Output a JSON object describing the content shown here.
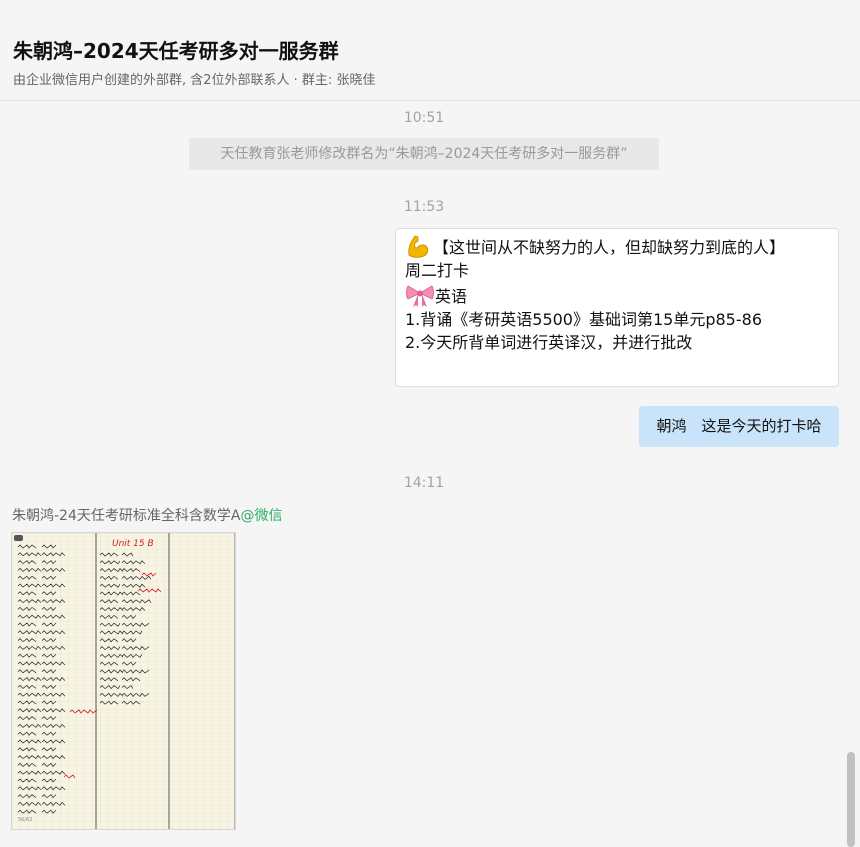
{
  "header": {
    "title": "朱朝鸿–2024天任考研多对一服务群",
    "subtitle": "由企业微信用户创建的外部群, 含2位外部联系人 · 群主: 张晓佳"
  },
  "messages": {
    "ts1": "10:51",
    "system_notice": "天任教育张老师修改群名为“朱朝鸿–2024天任考研多对一服务群”",
    "ts2": "11:53",
    "task": {
      "emoji1": "flexed-biceps-icon",
      "line1": "【这世间从不缺努力的人，但却缺努力到底的人】",
      "line2": "周二打卡",
      "emoji2": "ribbon-icon",
      "line3": "英语",
      "line4": "1.背诵《考研英语5500》基础词第15单元p85-86",
      "line5": "2.今天所背单词进行英译汉，并进行批改"
    },
    "reply": "朝鸿　这是今天的打卡哈",
    "ts3": "14:11",
    "sender_name": "朱朝鸿-24天任考研标准全科含数学A",
    "sender_source": "@微信",
    "image_header_text": "Unit 15 B"
  },
  "colors": {
    "accent_green": "#2aae67",
    "bubble_blue": "#c9e3fb",
    "ink_red": "#cc2222"
  }
}
